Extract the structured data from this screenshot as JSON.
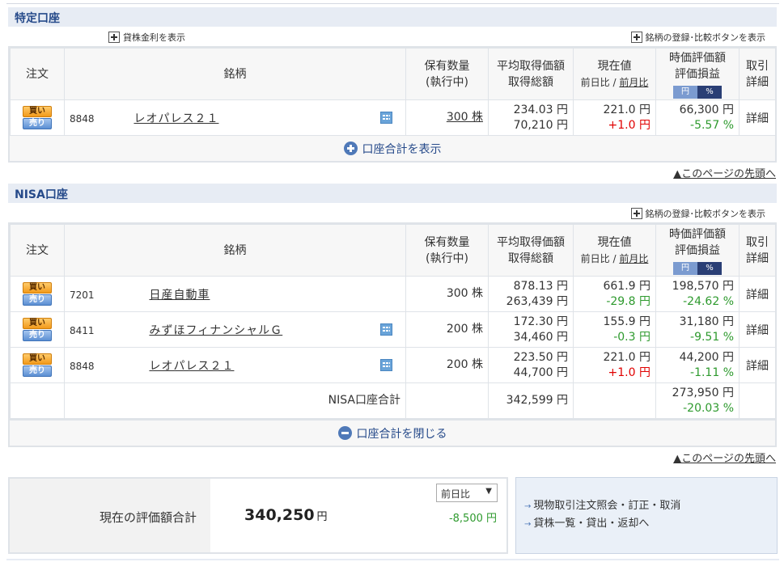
{
  "tokutei": {
    "title": "特定口座",
    "lending_toggle": "貸株金利を表示",
    "register_toggle": "銘柄の登録･比較ボタンを表示",
    "headers": {
      "order": "注文",
      "name": "銘柄",
      "qty1": "保有数量",
      "qty2": "(執行中)",
      "avg1": "平均取得価額",
      "avg2": "取得総額",
      "cur1": "現在値",
      "cur_day": "前日比",
      "cur_sep": " / ",
      "cur_month": "前月比",
      "val1": "時価評価額",
      "val2": "評価損益",
      "seg_yen": "円",
      "seg_pct": "%",
      "detail1": "取引",
      "detail2": "詳細"
    },
    "rows": [
      {
        "buy": "買い",
        "sell": "売り",
        "code": "8848",
        "name": "レオパレス２１",
        "qty": "300 株",
        "avg": "234.03 円",
        "total": "70,210 円",
        "price": "221.0 円",
        "change": "+1.0 円",
        "value": "66,300 円",
        "pl": "-5.57 %",
        "detail": "詳細"
      }
    ],
    "sum_toggle": "口座合計を表示",
    "page_top": "▲このページの先頭へ"
  },
  "nisa": {
    "title": "NISA口座",
    "register_toggle": "銘柄の登録･比較ボタンを表示",
    "headers": {
      "order": "注文",
      "name": "銘柄",
      "qty1": "保有数量",
      "qty2": "(執行中)",
      "avg1": "平均取得価額",
      "avg2": "取得総額",
      "cur1": "現在値",
      "cur_day": "前日比",
      "cur_sep": " / ",
      "cur_month": "前月比",
      "val1": "時価評価額",
      "val2": "評価損益",
      "seg_yen": "円",
      "seg_pct": "%",
      "detail1": "取引",
      "detail2": "詳細"
    },
    "rows": [
      {
        "buy": "買い",
        "sell": "売り",
        "code": "7201",
        "name": "日産自動車",
        "qty": "300 株",
        "avg": "878.13 円",
        "total": "263,439 円",
        "price": "661.9 円",
        "change": "-29.8 円",
        "value": "198,570 円",
        "pl": "-24.62 %",
        "detail": "詳細"
      },
      {
        "buy": "買い",
        "sell": "売り",
        "code": "8411",
        "name": "みずほフィナンシャルＧ",
        "qty": "200 株",
        "avg": "172.30 円",
        "total": "34,460 円",
        "price": "155.9 円",
        "change": "-0.3 円",
        "value": "31,180 円",
        "pl": "-9.51 %",
        "detail": "詳細"
      },
      {
        "buy": "買い",
        "sell": "売り",
        "code": "8848",
        "name": "レオパレス２１",
        "qty": "200 株",
        "avg": "223.50 円",
        "total": "44,700 円",
        "price": "221.0 円",
        "change": "+1.0 円",
        "value": "44,200 円",
        "pl": "-1.11 %",
        "detail": "詳細"
      }
    ],
    "total_row": {
      "label": "NISA口座合計",
      "total": "342,599 円",
      "value": "273,950 円",
      "pl": "-20.03 %"
    },
    "sum_toggle": "口座合計を閉じる",
    "page_top": "▲このページの先頭へ"
  },
  "summary": {
    "label": "現在の評価額合計",
    "value": "340,250",
    "yen": "円",
    "select_value": "前日比",
    "diff": "-8,500 円"
  },
  "links": [
    "現物取引注文照会・訂正・取消",
    "貸株一覧・貸出・返却へ"
  ],
  "colors": {
    "header_bg": "#e7ecf4",
    "title": "#264a8a",
    "up": "#e00000",
    "down": "#2e9a2e"
  }
}
